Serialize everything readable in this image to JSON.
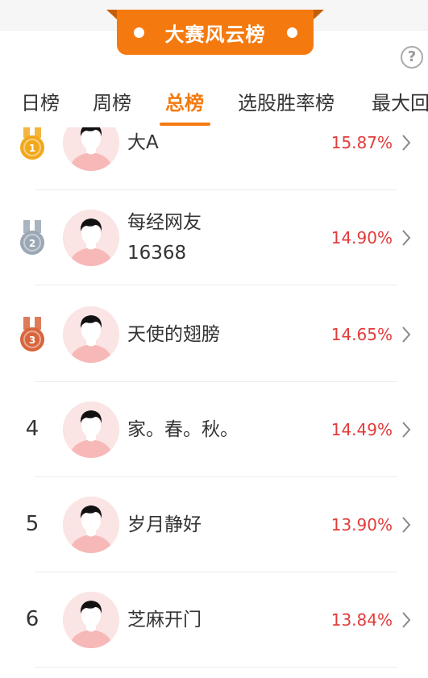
{
  "banner": {
    "title": "大赛风云榜"
  },
  "help": {
    "label": "?"
  },
  "tabs": [
    {
      "label": "日榜"
    },
    {
      "label": "周榜"
    },
    {
      "label": "总榜"
    },
    {
      "label": "选股胜率榜"
    },
    {
      "label": "最大回"
    }
  ],
  "active_tab": "总榜",
  "rows": [
    {
      "rank": "1",
      "medal": "gold-medal-icon",
      "name_lines": [
        "大A"
      ],
      "percent": "15.87%"
    },
    {
      "rank": "2",
      "medal": "silver-medal-icon",
      "name_lines": [
        "每经网友",
        "16368"
      ],
      "percent": "14.90%"
    },
    {
      "rank": "3",
      "medal": "bronze-medal-icon",
      "name_lines": [
        "天使的翅膀"
      ],
      "percent": "14.65%"
    },
    {
      "rank": "4",
      "medal": "",
      "name_lines": [
        "家。春。秋。"
      ],
      "percent": "14.49%"
    },
    {
      "rank": "5",
      "medal": "",
      "name_lines": [
        "岁月静好"
      ],
      "percent": "13.90%"
    },
    {
      "rank": "6",
      "medal": "",
      "name_lines": [
        "芝麻开门"
      ],
      "percent": "13.84%"
    }
  ],
  "colors": {
    "accent": "#f47a10",
    "percent_red": "#e23b3b",
    "gold": "#f2a81b",
    "silver": "#9aa7b4",
    "bronze": "#d8653d"
  }
}
